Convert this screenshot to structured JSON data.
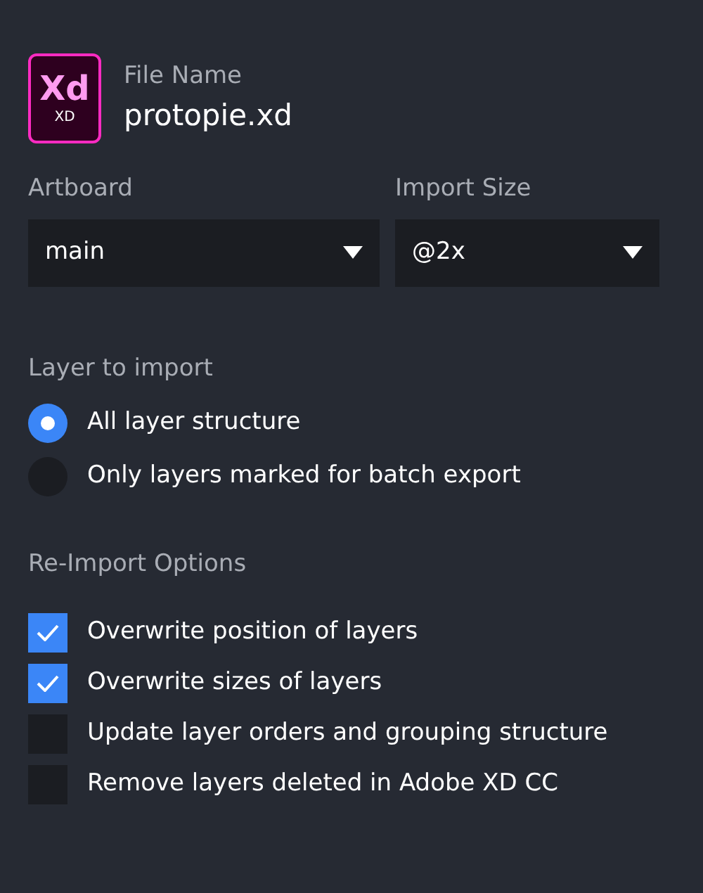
{
  "file": {
    "icon_text": "Xd",
    "icon_caption": "XD",
    "label": "File Name",
    "name": "protopie.xd"
  },
  "selects": [
    {
      "label": "Artboard",
      "value": "main"
    },
    {
      "label": "Import Size",
      "value": "@2x"
    }
  ],
  "layer_import": {
    "label": "Layer to import",
    "options": [
      {
        "label": "All layer structure",
        "selected": true
      },
      {
        "label": "Only layers marked for batch export",
        "selected": false
      }
    ]
  },
  "reimport": {
    "label": "Re-Import Options",
    "options": [
      {
        "label": "Overwrite position of layers",
        "checked": true
      },
      {
        "label": "Overwrite sizes of layers",
        "checked": true
      },
      {
        "label": "Update layer orders and grouping structure",
        "checked": false
      },
      {
        "label": "Remove layers deleted in Adobe XD CC",
        "checked": false
      }
    ]
  }
}
